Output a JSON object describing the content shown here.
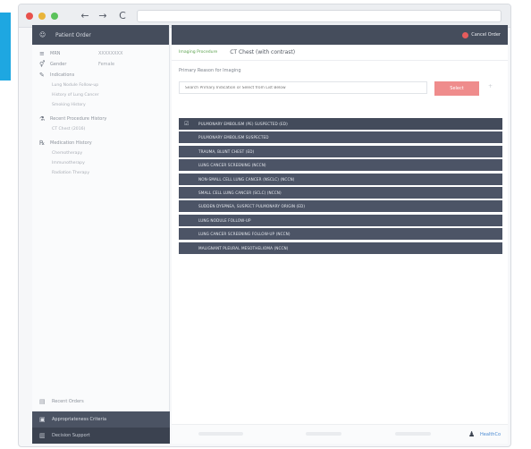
{
  "browser": {
    "nav_back": "←",
    "nav_forward": "→",
    "reload": "C"
  },
  "sidebar": {
    "header": "Patient Order",
    "rows": [
      {
        "icon": "≡",
        "label": "MRN",
        "value": "XXXXXXXX"
      },
      {
        "icon": "⚥",
        "label": "Gender",
        "value": "Female"
      },
      {
        "icon": "✎",
        "label": "Indications",
        "value": ""
      }
    ],
    "indication_items": [
      "Lung Nodule Follow-up",
      "History of Lung Cancer",
      "Smoking History"
    ],
    "section2": {
      "icon": "⚗",
      "label": "Recent Procedure History"
    },
    "section2_items": [
      "CT Chest (2016)"
    ],
    "section3": {
      "icon": "℞",
      "label": "Medication History"
    },
    "section3_items": [
      "Chemotherapy",
      "Immunotherapy",
      "Radiation Therapy"
    ],
    "bottom": [
      {
        "icon": "▤",
        "label": "Recent Orders"
      },
      {
        "icon": "▣",
        "label": "Appropriateness Criteria"
      },
      {
        "icon": "▥",
        "label": "Decision Support"
      }
    ]
  },
  "main": {
    "cancel_label": "Cancel Order",
    "breadcrumb_link": "Imaging Procedure",
    "breadcrumb_current": "CT Chest (with contrast)",
    "reason_label": "Primary Reason for Imaging",
    "reason_placeholder": "Search Primary Indication or Select from List Below",
    "reason_button": "Select",
    "reason_extra": "+",
    "indications": [
      "PULMONARY EMBOLISM (PE) SUSPECTED (ED)",
      "PULMONARY EMBOLISM SUSPECTED",
      "TRAUMA, BLUNT CHEST (ED)",
      "LUNG CANCER SCREENING (NCCN)",
      "NON-SMALL CELL LUNG CANCER (NSCLC) (NCCN)",
      "SMALL CELL LUNG CANCER (SCLC) (NCCN)",
      "SUDDEN DYSPNEA, SUSPECT PULMONARY ORIGIN (ED)",
      "LUNG NODULE FOLLOW-UP",
      "LUNG CANCER SCREENING FOLLOW-UP (NCCN)",
      "MALIGNANT PLEURAL MESOTHELIOMA (NCCN)"
    ],
    "first_check_icon": "☑",
    "footer_brand": "HealthCo"
  },
  "colors": {
    "accent": "#1ea7e1",
    "header_dark": "#454d5c",
    "list_item": "#4c5466",
    "cancel_dot": "#e65c5c",
    "select_button": "#ef8c8c",
    "breadcrumb_link": "#5ba24e"
  },
  "icons": {
    "window_controls": [
      "close-dot",
      "minimize-dot",
      "maximize-dot"
    ],
    "check": "check-square-icon",
    "cancel": "cancel-dot-icon"
  }
}
